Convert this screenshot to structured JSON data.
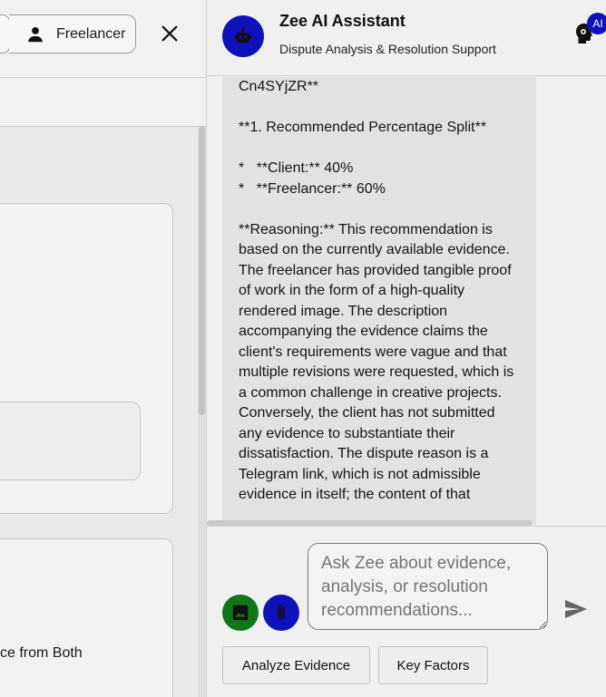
{
  "left_panel": {
    "role_button_label": "Freelancer",
    "role_icon": "person-icon",
    "close_icon": "close-icon",
    "evidence_text": "ce from Both"
  },
  "chat": {
    "title": "Zee AI Assistant",
    "subtitle": "Dispute Analysis & Resolution Support",
    "ai_badge": "AI",
    "avatar_icon": "robot-icon",
    "message_lines": [
      "Cn4SYjZR**",
      "",
      "**1. Recommended Percentage Split**",
      "",
      "*   **Client:** 40%",
      "*   **Freelancer:** 60%",
      "",
      "**Reasoning:** This recommendation is based on the currently available evidence. The freelancer has provided tangible proof of work in the form of a high-quality rendered image. The description accompanying the evidence claims the client's requirements were vague and that multiple revisions were requested, which is a common challenge in creative projects. Conversely, the client has not submitted any evidence to substantiate their dissatisfaction. The dispute reason is a Telegram link, which is not admissible evidence in itself; the content of that"
    ],
    "input_placeholder": "Ask Zee about evidence, analysis, or resolution recommendations...",
    "quick_actions": [
      "Analyze Evidence",
      "Key Factors"
    ],
    "colors": {
      "accent_blue": "#0f12b8",
      "image_button_green": "#10761a"
    }
  }
}
